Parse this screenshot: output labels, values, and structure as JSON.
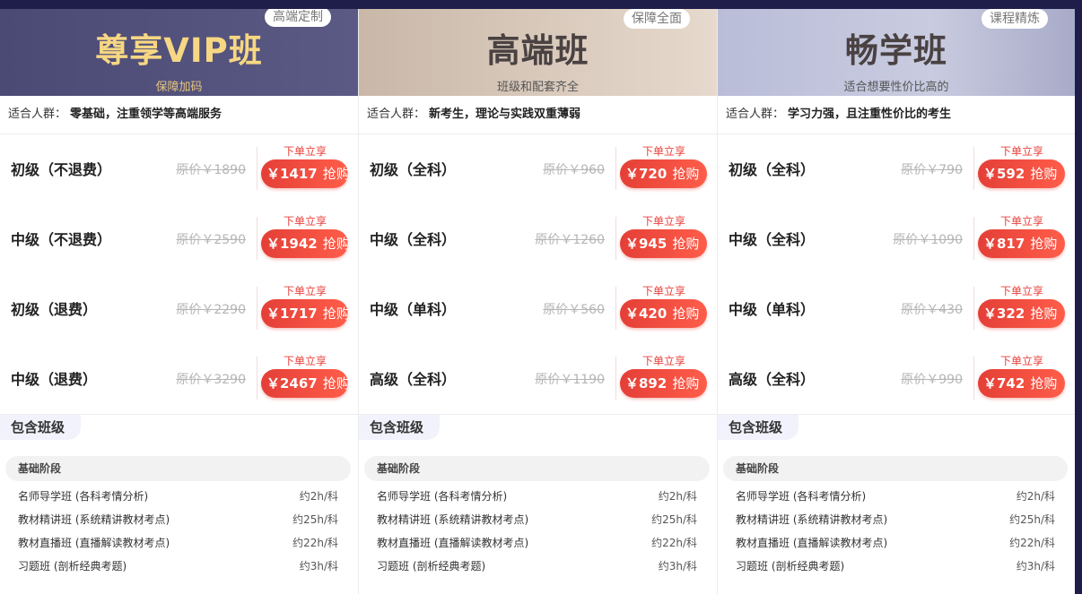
{
  "cards": [
    {
      "tag": "高端定制",
      "name": "尊享VIP班",
      "subtitle": "保障加码",
      "audience_label": "适合人群：",
      "audience_value": "零基础，注重领学等高端服务",
      "rows": [
        {
          "name": "初级（不退费）",
          "orig": "原价￥1890",
          "promo": "下单立享",
          "price": "￥1417",
          "action": "抢购"
        },
        {
          "name": "中级（不退费）",
          "orig": "原价￥2590",
          "promo": "下单立享",
          "price": "￥1942",
          "action": "抢购"
        },
        {
          "name": "初级（退费）",
          "orig": "原价￥2290",
          "promo": "下单立享",
          "price": "￥1717",
          "action": "抢购"
        },
        {
          "name": "中级（退费）",
          "orig": "原价￥3290",
          "promo": "下单立享",
          "price": "￥2467",
          "action": "抢购"
        }
      ],
      "includes_title": "包含班级",
      "stage": "基础阶段",
      "courses": [
        {
          "name": "名师导学班 (各科考情分析)",
          "duration": "约2h/科"
        },
        {
          "name": "教材精讲班 (系统精讲教材考点)",
          "duration": "约25h/科"
        },
        {
          "name": "教材直播班 (直播解读教材考点)",
          "duration": "约22h/科"
        },
        {
          "name": "习题班 (剖析经典考题)",
          "duration": "约3h/科"
        }
      ]
    },
    {
      "tag": "保障全面",
      "name": "高端班",
      "subtitle": "班级和配套齐全",
      "audience_label": "适合人群：",
      "audience_value": "新考生，理论与实践双重薄弱",
      "rows": [
        {
          "name": "初级（全科）",
          "orig": "原价￥960",
          "promo": "下单立享",
          "price": "￥720",
          "action": "抢购"
        },
        {
          "name": "中级（全科）",
          "orig": "原价￥1260",
          "promo": "下单立享",
          "price": "￥945",
          "action": "抢购"
        },
        {
          "name": "中级（单科）",
          "orig": "原价￥560",
          "promo": "下单立享",
          "price": "￥420",
          "action": "抢购"
        },
        {
          "name": "高级（全科）",
          "orig": "原价￥1190",
          "promo": "下单立享",
          "price": "￥892",
          "action": "抢购"
        }
      ],
      "includes_title": "包含班级",
      "stage": "基础阶段",
      "courses": [
        {
          "name": "名师导学班 (各科考情分析)",
          "duration": "约2h/科"
        },
        {
          "name": "教材精讲班 (系统精讲教材考点)",
          "duration": "约25h/科"
        },
        {
          "name": "教材直播班 (直播解读教材考点)",
          "duration": "约22h/科"
        },
        {
          "name": "习题班 (剖析经典考题)",
          "duration": "约3h/科"
        }
      ]
    },
    {
      "tag": "课程精炼",
      "name": "畅学班",
      "subtitle": "适合想要性价比高的",
      "audience_label": "适合人群：",
      "audience_value": "学习力强，且注重性价比的考生",
      "rows": [
        {
          "name": "初级（全科）",
          "orig": "原价￥790",
          "promo": "下单立享",
          "price": "￥592",
          "action": "抢购"
        },
        {
          "name": "中级（全科）",
          "orig": "原价￥1090",
          "promo": "下单立享",
          "price": "￥817",
          "action": "抢购"
        },
        {
          "name": "中级（单科）",
          "orig": "原价￥430",
          "promo": "下单立享",
          "price": "￥322",
          "action": "抢购"
        },
        {
          "name": "高级（全科）",
          "orig": "原价￥990",
          "promo": "下单立享",
          "price": "￥742",
          "action": "抢购"
        }
      ],
      "includes_title": "包含班级",
      "stage": "基础阶段",
      "courses": [
        {
          "name": "名师导学班 (各科考情分析)",
          "duration": "约2h/科"
        },
        {
          "name": "教材精讲班 (系统精讲教材考点)",
          "duration": "约25h/科"
        },
        {
          "name": "教材直播班 (直播解读教材考点)",
          "duration": "约22h/科"
        },
        {
          "name": "习题班 (剖析经典考题)",
          "duration": "约3h/科"
        }
      ]
    }
  ]
}
